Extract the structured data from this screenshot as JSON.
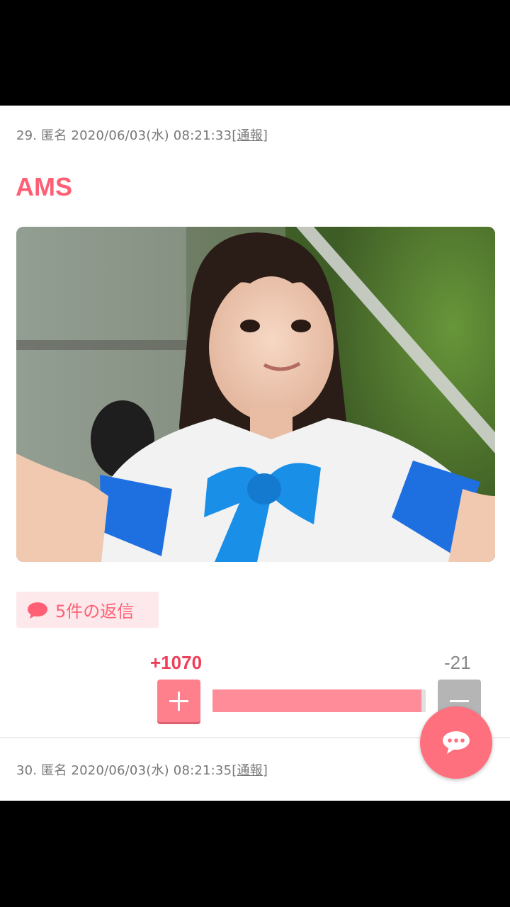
{
  "post29": {
    "number": "29.",
    "author": "匿名",
    "datetime": "2020/06/03(水) 08:21:33",
    "report_open": "[",
    "report_label": "通報",
    "report_close": "]",
    "title": "AMS",
    "image": "photo-of-girl-in-white-and-blue-uniform",
    "replies_label": "5件の返信",
    "plus_count": "+1070",
    "minus_count": "-21",
    "vote_ratio": 0.98
  },
  "post30": {
    "number": "30.",
    "author": "匿名",
    "datetime": "2020/06/03(水) 08:21:35",
    "report_open": "[",
    "report_label": "通報",
    "report_close": "]"
  },
  "icons": {
    "reply": "speech-bubble-icon",
    "plus": "plus-icon",
    "minus": "minus-icon",
    "fab": "chat-bubble-icon"
  },
  "colors": {
    "accent": "#ff5f74",
    "plus_button": "#ff808d",
    "minus_button": "#b5b5b5",
    "bar_fill": "#ff8c99",
    "fab": "#ff707f"
  }
}
